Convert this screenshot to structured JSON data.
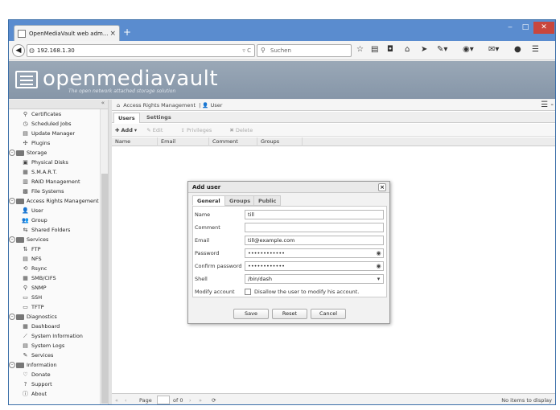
{
  "browser": {
    "tab_title": "OpenMediaVault web adm...",
    "tab_close": "×",
    "new_tab": "+",
    "window_controls": [
      "‒",
      "□",
      "✕"
    ],
    "url": "192.168.1.30",
    "search_placeholder": "Suchen"
  },
  "omv": {
    "logo": "openmediavault",
    "tagline": "The open network attached storage solution"
  },
  "sidebar": {
    "collapse": "«",
    "items": [
      {
        "label": "Certificates",
        "level": 1,
        "icon": "certificate-icon"
      },
      {
        "label": "Scheduled Jobs",
        "level": 1,
        "icon": "clock-icon"
      },
      {
        "label": "Update Manager",
        "level": 1,
        "icon": "update-icon"
      },
      {
        "label": "Plugins",
        "level": 1,
        "icon": "plugin-icon"
      },
      {
        "label": "Storage",
        "level": 0,
        "icon": "folder-icon"
      },
      {
        "label": "Physical Disks",
        "level": 1,
        "icon": "disk-icon"
      },
      {
        "label": "S.M.A.R.T.",
        "level": 1,
        "icon": "smart-icon"
      },
      {
        "label": "RAID Management",
        "level": 1,
        "icon": "raid-icon"
      },
      {
        "label": "File Systems",
        "level": 1,
        "icon": "filesystem-icon"
      },
      {
        "label": "Access Rights Management",
        "level": 0,
        "icon": "folder-icon"
      },
      {
        "label": "User",
        "level": 1,
        "icon": "user-icon"
      },
      {
        "label": "Group",
        "level": 1,
        "icon": "group-icon"
      },
      {
        "label": "Shared Folders",
        "level": 1,
        "icon": "share-icon"
      },
      {
        "label": "Services",
        "level": 0,
        "icon": "folder-icon"
      },
      {
        "label": "FTP",
        "level": 1,
        "icon": "ftp-icon"
      },
      {
        "label": "NFS",
        "level": 1,
        "icon": "nfs-icon"
      },
      {
        "label": "Rsync",
        "level": 1,
        "icon": "rsync-icon"
      },
      {
        "label": "SMB/CIFS",
        "level": 1,
        "icon": "smb-icon"
      },
      {
        "label": "SNMP",
        "level": 1,
        "icon": "snmp-icon"
      },
      {
        "label": "SSH",
        "level": 1,
        "icon": "ssh-icon"
      },
      {
        "label": "TFTP",
        "level": 1,
        "icon": "tftp-icon"
      },
      {
        "label": "Diagnostics",
        "level": 0,
        "icon": "folder-icon"
      },
      {
        "label": "Dashboard",
        "level": 1,
        "icon": "dashboard-icon"
      },
      {
        "label": "System Information",
        "level": 1,
        "icon": "sysinfo-icon"
      },
      {
        "label": "System Logs",
        "level": 1,
        "icon": "logs-icon"
      },
      {
        "label": "Services",
        "level": 1,
        "icon": "services-icon"
      },
      {
        "label": "Information",
        "level": 0,
        "icon": "folder-icon"
      },
      {
        "label": "Donate",
        "level": 1,
        "icon": "heart-icon"
      },
      {
        "label": "Support",
        "level": 1,
        "icon": "question-icon"
      },
      {
        "label": "About",
        "level": 1,
        "icon": "info-icon"
      }
    ]
  },
  "main": {
    "breadcrumb": [
      "Access Rights Management",
      "User"
    ],
    "tabs": [
      "Users",
      "Settings"
    ],
    "toolbar": {
      "add": "Add",
      "edit": "Edit",
      "privileges": "Privileges",
      "delete": "Delete"
    },
    "columns": [
      "Name",
      "Email",
      "Comment",
      "Groups"
    ],
    "pager": {
      "page_label": "Page",
      "page_value": "",
      "of_label": "of 0",
      "status": "No items to display"
    }
  },
  "dialog": {
    "title": "Add user",
    "tabs": [
      "General",
      "Groups",
      "Public keys"
    ],
    "fields": [
      {
        "label": "Name",
        "value": "till"
      },
      {
        "label": "Comment",
        "value": ""
      },
      {
        "label": "Email",
        "value": "till@example.com"
      },
      {
        "label": "Password",
        "value": "••••••••••••"
      },
      {
        "label": "Confirm password",
        "value": "••••••••••••"
      },
      {
        "label": "Shell",
        "value": "/bin/dash"
      }
    ],
    "modify_account_label": "Modify account",
    "modify_account_text": "Disallow the user to modify his account.",
    "buttons": {
      "save": "Save",
      "reset": "Reset",
      "cancel": "Cancel"
    }
  }
}
